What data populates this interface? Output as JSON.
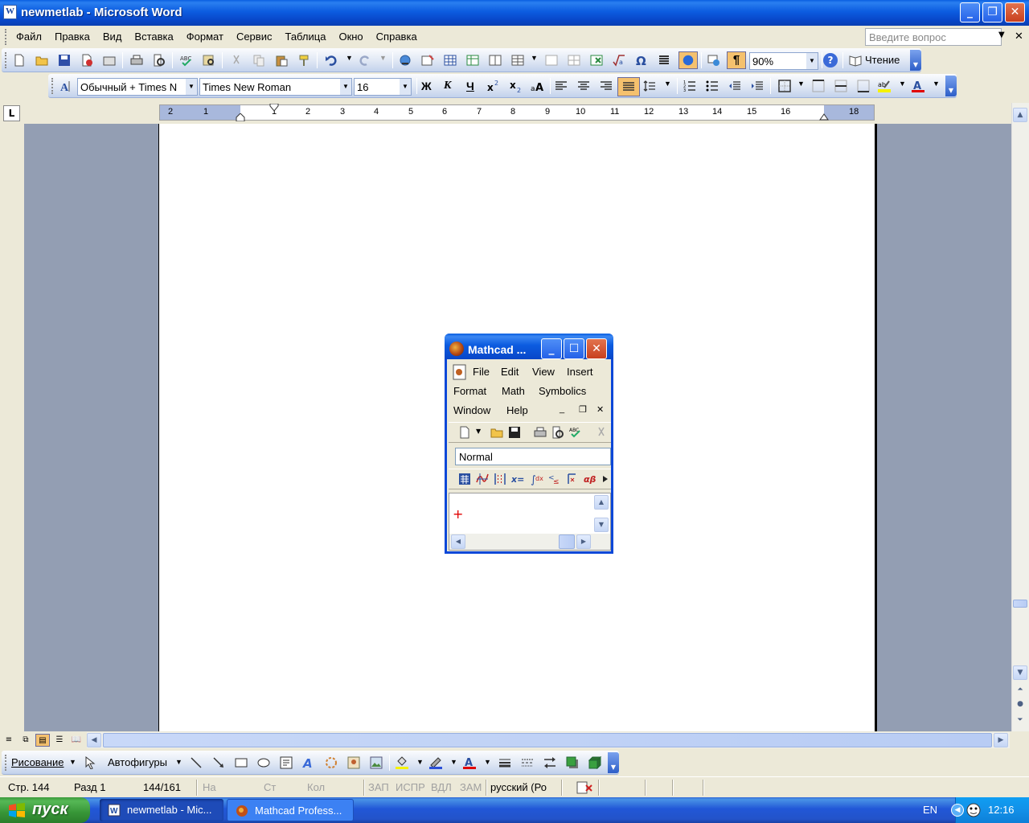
{
  "window": {
    "title": "newmetlab - Microsoft Word"
  },
  "menu": {
    "items": [
      "Файл",
      "Правка",
      "Вид",
      "Вставка",
      "Формат",
      "Сервис",
      "Таблица",
      "Окно",
      "Справка"
    ],
    "ask_placeholder": "Введите вопрос"
  },
  "standard_toolbar": {
    "zoom": "90%",
    "reading_label": "Чтение"
  },
  "formatting_toolbar": {
    "style": "Обычный + Times N",
    "font": "Times New Roman",
    "size": "16",
    "bold": "Ж",
    "italic": "К",
    "underline": "Ч"
  },
  "ruler": {
    "tab_selector": "L",
    "numbers": [
      "2",
      "1",
      "1",
      "2",
      "3",
      "4",
      "5",
      "6",
      "7",
      "8",
      "9",
      "10",
      "11",
      "12",
      "13",
      "14",
      "15",
      "16",
      "18"
    ]
  },
  "drawing_toolbar": {
    "draw_label": "Рисование",
    "autoshapes_label": "Автофигуры"
  },
  "status_bar": {
    "page": "Стр. 144",
    "section": "Разд 1",
    "pages": "144/161",
    "at": "На",
    "line": "Ст",
    "col": "Кол",
    "rec": "ЗАП",
    "trk": "ИСПР",
    "ext": "ВДЛ",
    "ovr": "ЗАМ",
    "language": "русский (Ро"
  },
  "taskbar": {
    "start_label": "пуск",
    "items": [
      "newmetlab - Mic...",
      "Mathcad Profess..."
    ],
    "language": "EN",
    "clock": "12:16"
  },
  "mathcad": {
    "title": "Mathcad ...",
    "menu_row1": [
      "File",
      "Edit",
      "View",
      "Insert"
    ],
    "menu_row2": [
      "Format",
      "Math",
      "Symbolics"
    ],
    "menu_row3": [
      "Window",
      "Help"
    ],
    "style": "Normal"
  },
  "colors": {
    "xp_blue": "#0a5fe0",
    "start_green": "#379537",
    "page_bg": "#939eb3",
    "cursor_red": "#e00000"
  }
}
